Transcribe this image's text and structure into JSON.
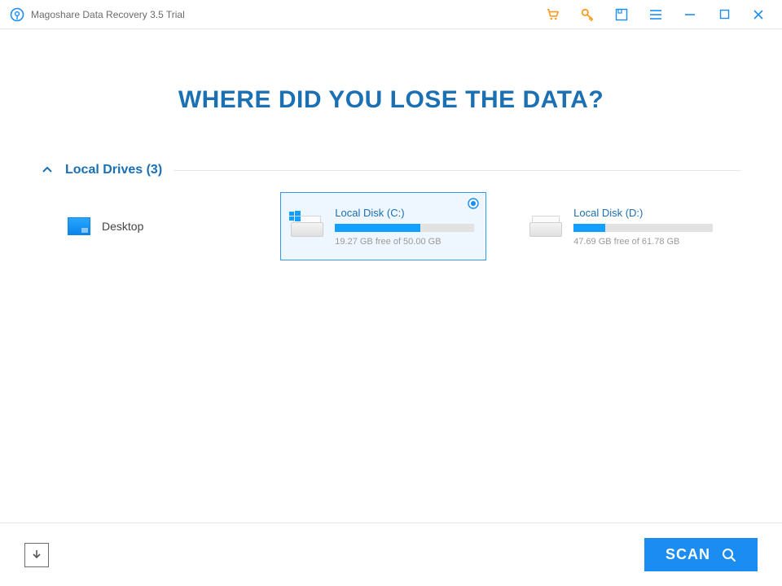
{
  "titlebar": {
    "app_title": "Magoshare Data Recovery 3.5 Trial"
  },
  "headline": "WHERE DID YOU LOSE THE DATA?",
  "section": {
    "label": "Local Drives (3)"
  },
  "drives": [
    {
      "kind": "desktop",
      "name": "Desktop",
      "selected": false
    },
    {
      "kind": "system-disk",
      "name": "Local Disk (C:)",
      "free_text": "19.27 GB free of 50.00 GB",
      "used_percent": 61,
      "selected": true
    },
    {
      "kind": "disk",
      "name": "Local Disk (D:)",
      "free_text": "47.69 GB free of 61.78 GB",
      "used_percent": 23,
      "selected": false
    }
  ],
  "footer": {
    "scan_label": "SCAN"
  },
  "colors": {
    "accent": "#1b8df2",
    "heading": "#1b6fb3"
  }
}
